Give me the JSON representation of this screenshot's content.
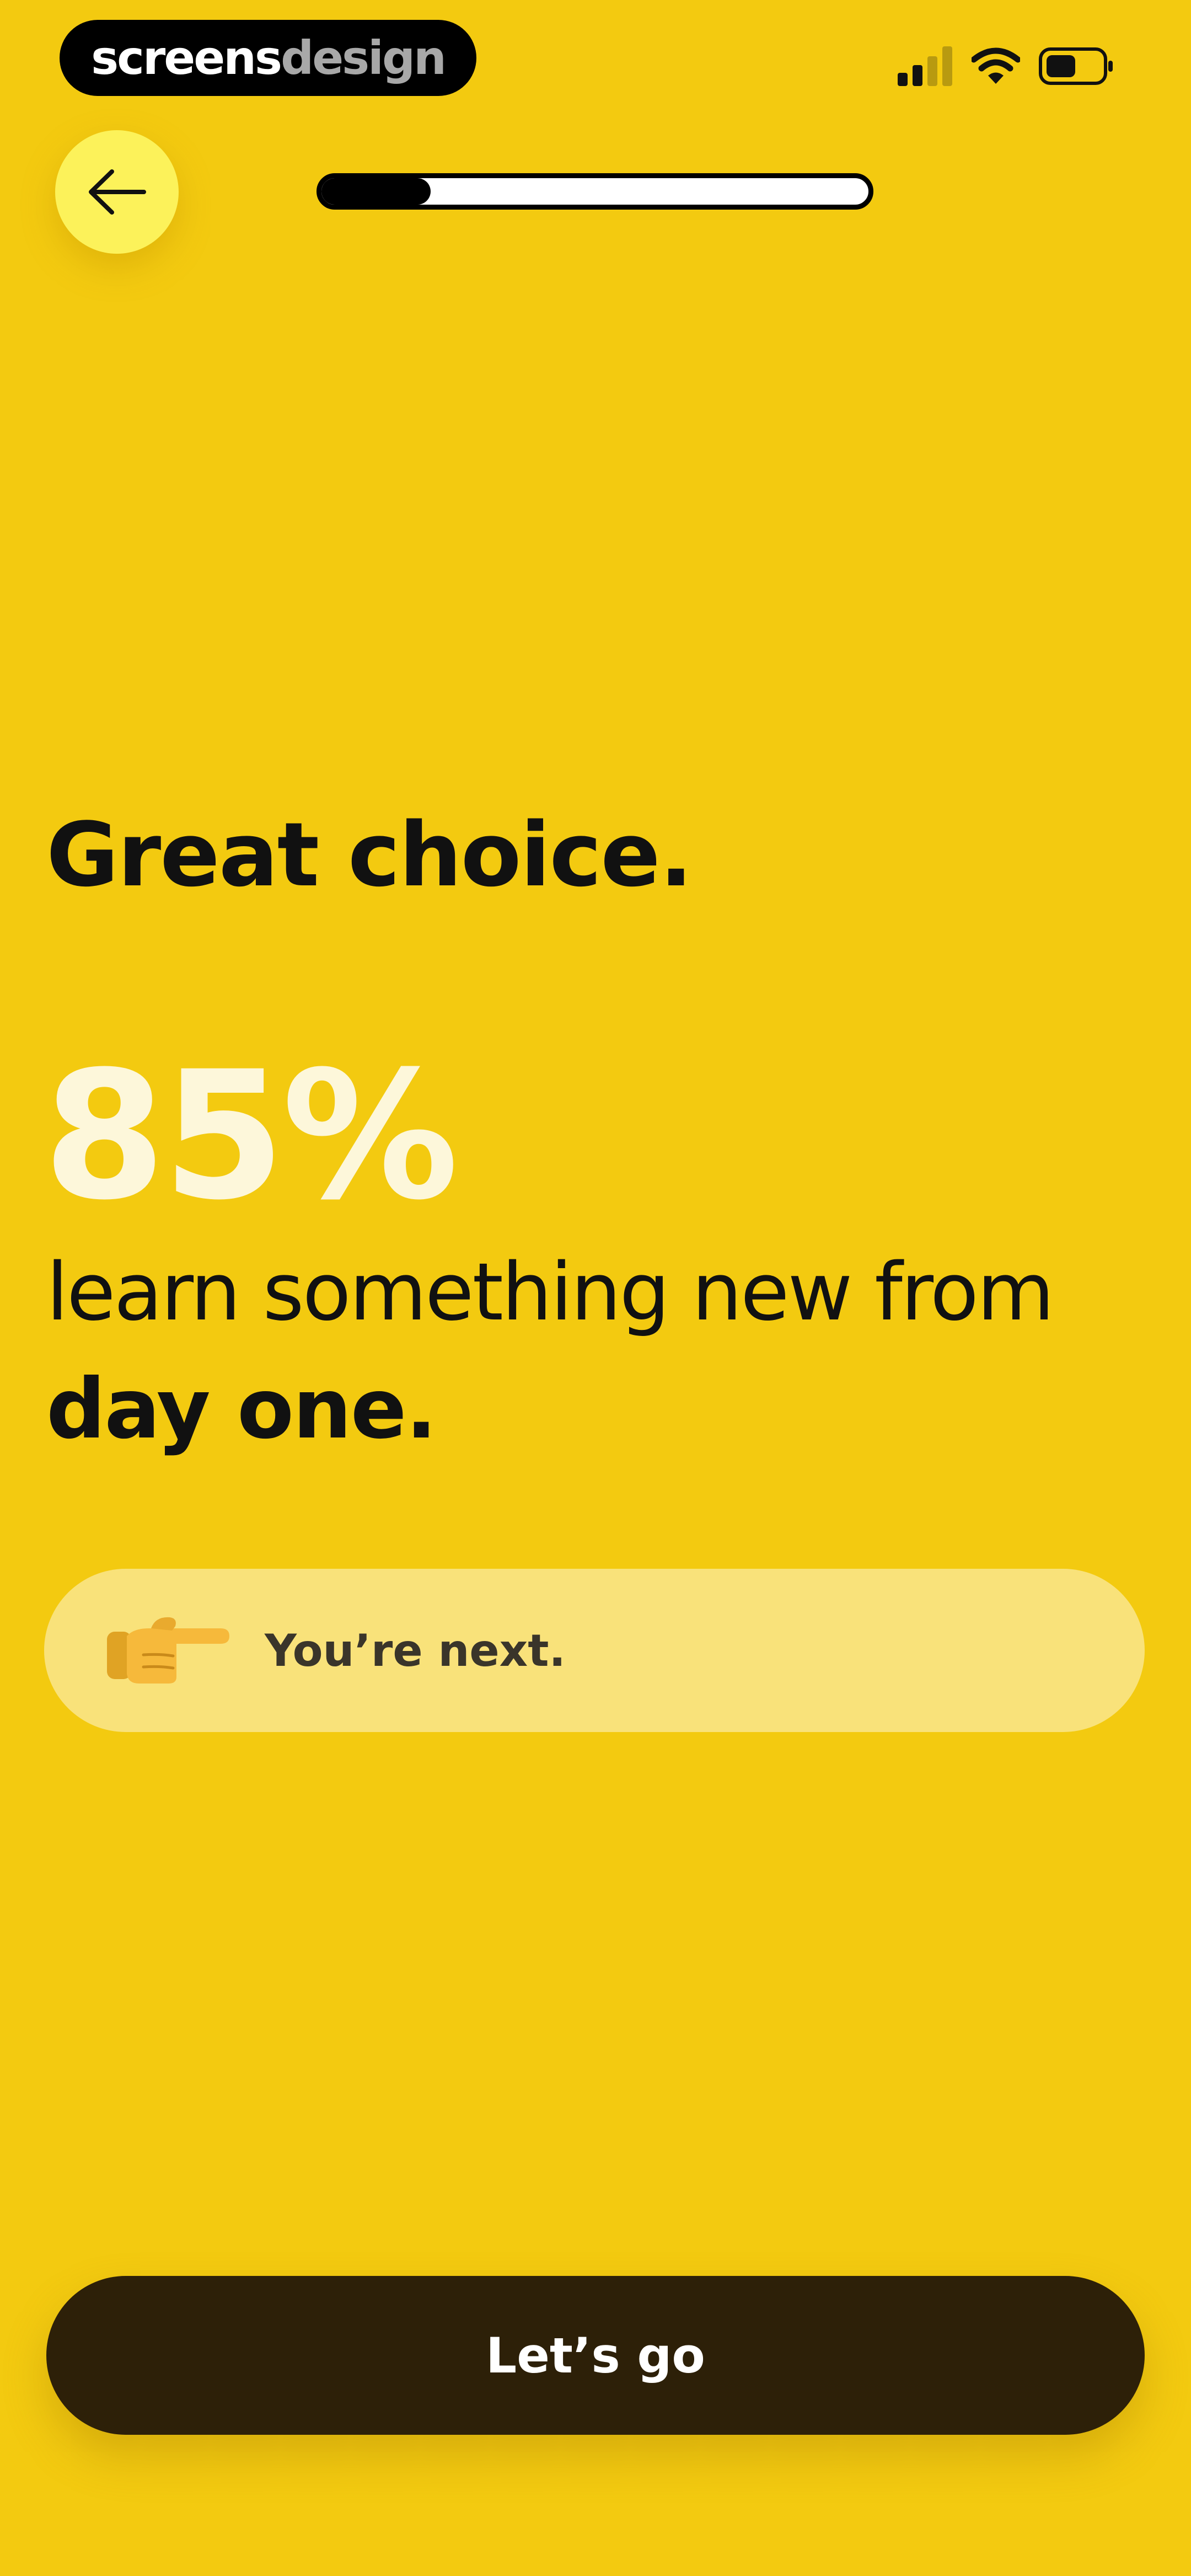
{
  "brand": {
    "name_part1": "screens",
    "name_part2": "design"
  },
  "status_bar": {
    "signal_icon": "cellular-signal-icon",
    "wifi_icon": "wifi-icon",
    "battery_icon": "battery-icon"
  },
  "nav": {
    "back_icon": "arrow-left-icon",
    "progress": 0.2
  },
  "content": {
    "headline": "Great choice.",
    "stat_value": "85%",
    "stat_text_line1": "learn something new from",
    "stat_text_line2": "day one.",
    "next_icon": "pointing-right-hand-icon",
    "next_text": "You’re next."
  },
  "cta": {
    "label": "Let’s go"
  },
  "colors": {
    "background": "#F3CA10",
    "back_button": "#FCF25A",
    "card": "#F9E27A",
    "cta": "#2D2008",
    "stat": "#FDF7DA"
  }
}
